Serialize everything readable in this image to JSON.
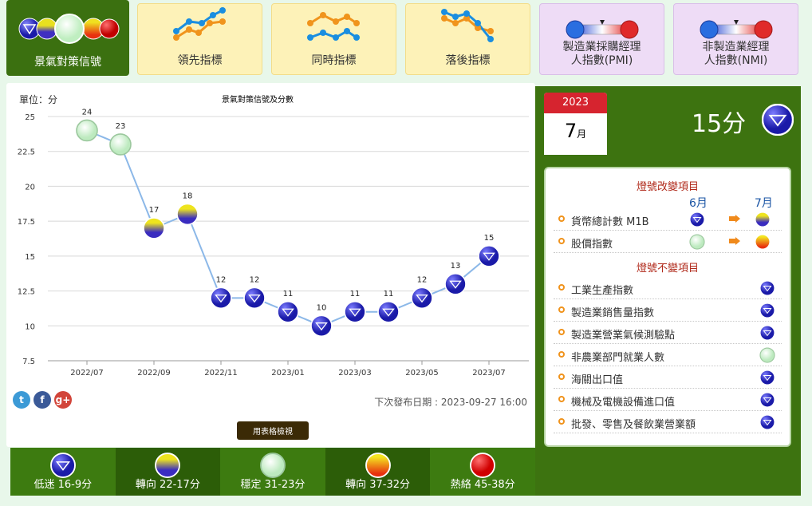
{
  "nav": {
    "tabs": [
      {
        "label": "景氣對策信號"
      },
      {
        "label": "領先指標"
      },
      {
        "label": "同時指標"
      },
      {
        "label": "落後指標"
      },
      {
        "label": "製造業採購經理\n人指數(PMI)"
      },
      {
        "label": "非製造業經理\n人指數(NMI)"
      }
    ]
  },
  "chart": {
    "unit_label": "單位：分",
    "title": "景氣對策信號及分數",
    "next_release": "下次發布日期 : 2023-09-27 16:00",
    "table_button": "用表格檢視"
  },
  "chart_data": {
    "type": "line",
    "title": "景氣對策信號及分數",
    "ylabel": "單位：分",
    "ylim": [
      7.5,
      25
    ],
    "yticks": [
      "25",
      "22.5",
      "20",
      "17.5",
      "15",
      "12.5",
      "10",
      "7.5"
    ],
    "xticks": [
      "2022/07",
      "2022/09",
      "2022/11",
      "2023/01",
      "2023/03",
      "2023/05",
      "2023/07"
    ],
    "x": [
      "2022/07",
      "2022/08",
      "2022/09",
      "2022/10",
      "2022/11",
      "2022/12",
      "2023/01",
      "2023/02",
      "2023/03",
      "2023/04",
      "2023/05",
      "2023/06",
      "2023/07"
    ],
    "values": [
      24,
      23,
      17,
      18,
      12,
      12,
      11,
      10,
      11,
      11,
      12,
      13,
      15
    ],
    "signals": [
      "green",
      "green",
      "yellow-blue",
      "yellow-blue",
      "blue",
      "blue",
      "blue",
      "blue",
      "blue",
      "blue",
      "blue",
      "blue",
      "blue"
    ],
    "grid": true,
    "line_color": "#8cb8e8"
  },
  "legend": [
    {
      "label": "低迷 16-9分",
      "signal": "blue"
    },
    {
      "label": "轉向 22-17分",
      "signal": "yellow-blue"
    },
    {
      "label": "穩定 31-23分",
      "signal": "green"
    },
    {
      "label": "轉向 37-32分",
      "signal": "yellow-red"
    },
    {
      "label": "熱絡 45-38分",
      "signal": "red"
    }
  ],
  "current": {
    "year": "2023",
    "month": "7",
    "month_suffix": "月",
    "score": "15分",
    "signal": "blue"
  },
  "changes": {
    "title": "燈號改變項目",
    "prev_month": "6月",
    "cur_month": "7月",
    "items": [
      {
        "name": "貨幣總計數 M1B",
        "prev": "blue",
        "cur": "yellow-blue"
      },
      {
        "name": "股價指數",
        "prev": "green",
        "cur": "yellow-red"
      }
    ]
  },
  "unchanged": {
    "title": "燈號不變項目",
    "items": [
      {
        "name": "工業生產指數",
        "signal": "blue"
      },
      {
        "name": "製造業銷售量指數",
        "signal": "blue"
      },
      {
        "name": "製造業營業氣候測驗點",
        "signal": "blue"
      },
      {
        "name": "非農業部門就業人數",
        "signal": "green"
      },
      {
        "name": "海關出口值",
        "signal": "blue"
      },
      {
        "name": "機械及電機設備進口值",
        "signal": "blue"
      },
      {
        "name": "批發、零售及餐飲業營業額",
        "signal": "blue"
      }
    ]
  },
  "colors": {
    "dark_green": "#3d7310",
    "signal_blue": "#1f1fb4",
    "signal_green": "#cdf2cd",
    "signal_red": "#e01818",
    "calendar_red": "#d6242f",
    "section_title": "#b0291a"
  }
}
